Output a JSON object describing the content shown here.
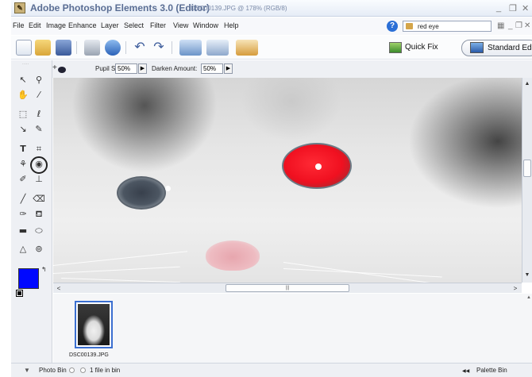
{
  "title_bar": {
    "app_title": "Adobe Photoshop Elements 3.0 (Editor)",
    "document": "DSC00139.JPG @ 178% (RGB/8)",
    "min_btn": "_",
    "restore_btn": "❐",
    "close_btn": "✕"
  },
  "menu": {
    "items": [
      "File",
      "Edit",
      "Image",
      "Enhance",
      "Layer",
      "Select",
      "Filter",
      "View",
      "Window",
      "Help"
    ],
    "search_value": "red eye",
    "min_btn": "_",
    "restore_btn": "❐",
    "close_btn": "✕"
  },
  "toolbar": {
    "quick_fix_label": "Quick Fix",
    "standard_edit_label": "Standard Edit"
  },
  "options_bar": {
    "pupil_size_label": "Pupil Size:",
    "pupil_size_value": "50%",
    "darken_amount_label": "Darken Amount:",
    "darken_amount_value": "50%",
    "arrow": "▶"
  },
  "toolbox": {
    "foreground_color": "#0008ff"
  },
  "scrollbars": {
    "up": "▲",
    "down": "▼",
    "left": "<",
    "right": ">",
    "h_grip": "|||"
  },
  "photo_bin": {
    "thumbnail_label": "DSC00139.JPG"
  },
  "status_bar": {
    "toggle": "▼",
    "photo_bin_label": "Photo Bin",
    "count_label": "1 file in bin",
    "palette_bin_arrow": "◀◀",
    "palette_bin_label": "Palette Bin"
  },
  "colors": {
    "accent": "#3b6fd0",
    "red_eye": "#f01020"
  }
}
